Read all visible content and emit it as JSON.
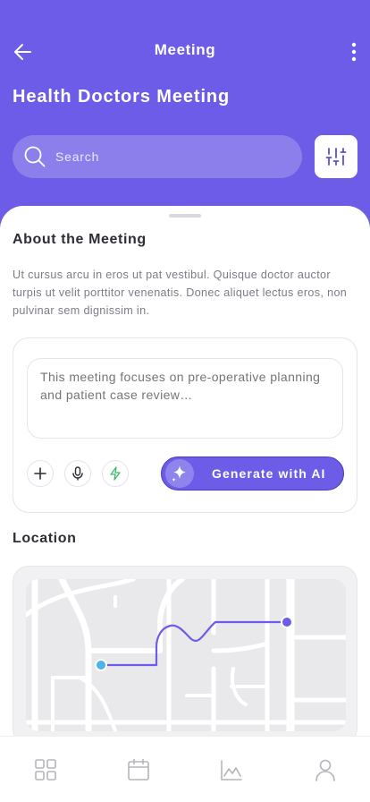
{
  "header": {
    "title": "Meeting",
    "page_title": "Health Doctors Meeting",
    "background": "#6c5ce7",
    "back_icon": "arrow-left-icon",
    "more_icon": "more-vertical-icon"
  },
  "search": {
    "placeholder": "Search",
    "value": "",
    "icon": "search-icon",
    "filter_icon": "sliders-icon"
  },
  "about": {
    "title": "About the Meeting",
    "text": "Ut cursus arcu in eros ut pat vestibul. Quisque doctor auctor turpis ut velit porttitor venenatis. Donec aliquet lectus eros, non pulvinar sem dignissim in."
  },
  "ai": {
    "prompt_placeholder": "This meeting focuses on pre-operative planning and patient case review…",
    "tools": [
      "plus-icon",
      "microphone-icon",
      "lightning-icon"
    ],
    "generate_label": "Generate with AI",
    "generate_icon": "sparkle-icon",
    "accent": "#6c5ce7"
  },
  "location": {
    "title": "Location",
    "start_marker_color": "#4fb3e8",
    "end_marker_color": "#6c5ce7",
    "route_color": "#6c5ce7"
  },
  "nav": {
    "items": [
      "grid-icon",
      "calendar-icon",
      "chart-icon",
      "user-icon"
    ]
  }
}
